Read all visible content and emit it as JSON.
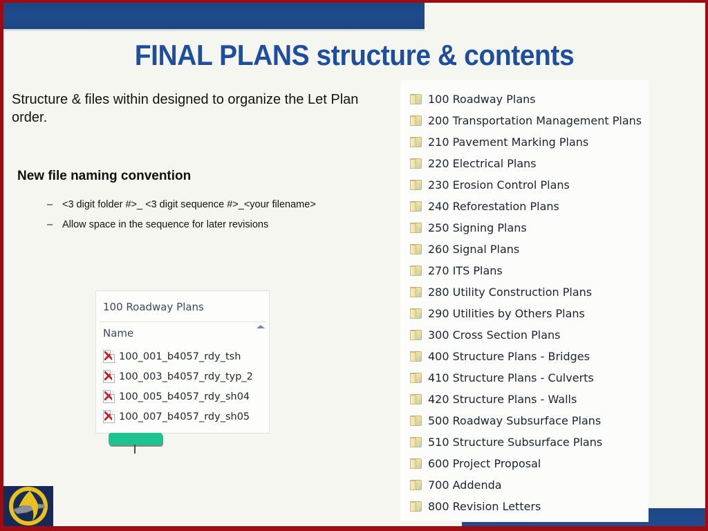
{
  "slide": {
    "title": "FINAL PLANS structure & contents",
    "accent_blue": "#1f4e9c",
    "bar_blue": "#1d4582",
    "border_red": "#9c0d13",
    "background": "#f6f6f1"
  },
  "content": {
    "paragraph": "Structure & files within designed to organize the Let Plan order.",
    "subhead": "New file naming convention",
    "bullets": [
      {
        "dash": "–",
        "text": "<3 digit folder #>_ <3 digit sequence #>_<your filename>"
      },
      {
        "dash": "–",
        "text": "Allow space in the sequence for later revisions"
      }
    ]
  },
  "explorer_inset": {
    "folder_title": "100 Roadway Plans",
    "column_header": "Name",
    "sort_icon": "sort-ascending-icon",
    "files": [
      "100_001_b4057_rdy_tsh",
      "100_003_b4057_rdy_typ_2",
      "100_005_b4057_rdy_sh04",
      "100_007_b4057_rdy_sh05"
    ],
    "callout_color": "#1fc38f"
  },
  "folder_list": {
    "items": [
      "100 Roadway Plans",
      "200 Transportation Management Plans",
      "210 Pavement Marking Plans",
      "220 Electrical Plans",
      "230 Erosion Control Plans",
      "240 Reforestation Plans",
      "250 Signing Plans",
      "260 Signal Plans",
      "270 ITS Plans",
      "280 Utility Construction Plans",
      "290 Utilities by Others Plans",
      "300 Cross Section Plans",
      "400 Structure Plans - Bridges",
      "410 Structure Plans - Culverts",
      "420 Structure Plans - Walls",
      "500 Roadway Subsurface Plans",
      "510 Structure Subsurface Plans",
      "600 Project Proposal",
      "700 Addenda",
      "800 Revision Letters"
    ]
  },
  "logo": {
    "name": "ncdot-logo",
    "circle_color": "#e8c01f",
    "field_color": "#152a57"
  }
}
